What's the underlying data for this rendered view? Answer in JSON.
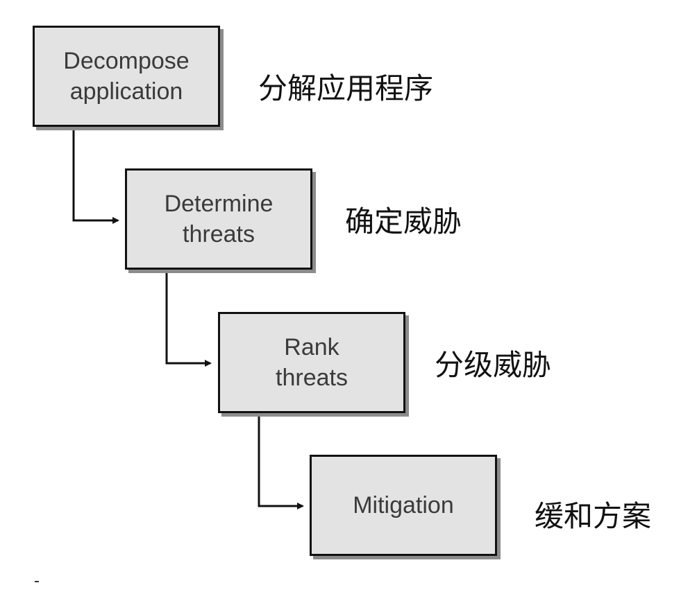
{
  "steps": [
    {
      "en": "Decompose\napplication",
      "zh": "分解应用程序"
    },
    {
      "en": "Determine\nthreats",
      "zh": "确定威胁"
    },
    {
      "en": "Rank\nthreats",
      "zh": "分级威胁"
    },
    {
      "en": "Mitigation",
      "zh": "缓和方案"
    }
  ],
  "colors": {
    "box_fill": "#e3e3e3",
    "box_border": "#111111",
    "box_shadow": "#8c8c8c",
    "connector": "#111111"
  }
}
